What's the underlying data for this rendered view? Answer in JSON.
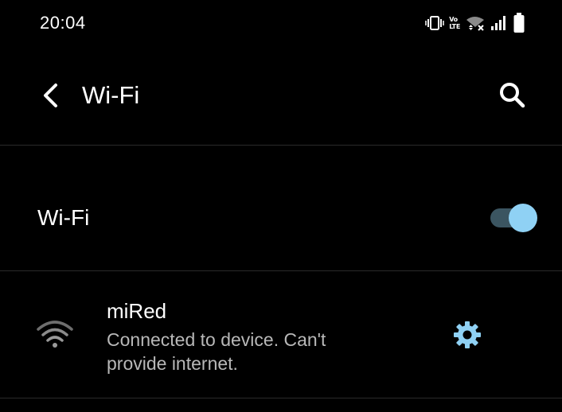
{
  "status_bar": {
    "time": "20:04",
    "volte_line1": "Vo",
    "volte_line2": "LTE",
    "icons": [
      "vibrate-icon",
      "volte-icon",
      "wifi-no-internet-icon",
      "cellular-signal-icon",
      "battery-icon"
    ]
  },
  "app_bar": {
    "title": "Wi-Fi",
    "back_icon": "chevron-left-icon",
    "search_icon": "search-icon"
  },
  "wifi_toggle": {
    "label": "Wi-Fi",
    "enabled": true
  },
  "network": {
    "name": "miRed",
    "status_line1": "Connected to device. Can't",
    "status_line2": "provide internet.",
    "signal_icon": "wifi-signal-icon",
    "settings_icon": "gear-icon"
  },
  "colors": {
    "background": "#000000",
    "text_primary": "#ffffff",
    "text_secondary": "#b8b8b8",
    "accent": "#8fd1f4",
    "switch_track": "#3b5561",
    "divider": "#2a2a2a"
  }
}
